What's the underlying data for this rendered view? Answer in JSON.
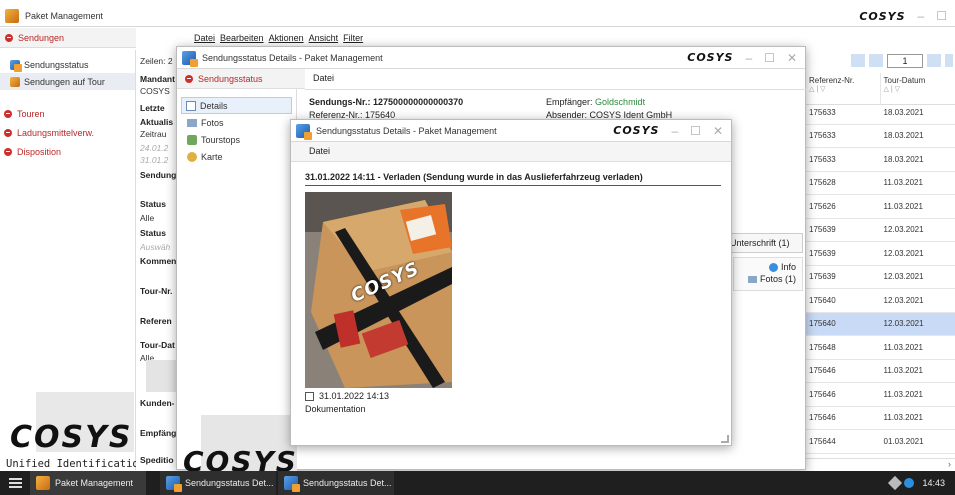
{
  "main_window": {
    "title": "Paket Management",
    "brand": "COSYS",
    "tab": "Sendungen",
    "menu": [
      "Datei",
      "Bearbeiten",
      "Aktionen",
      "Ansicht",
      "Filter"
    ],
    "zeilen_label": "Zeilen: 2",
    "page_number": "1"
  },
  "sidebar": {
    "sub_items": [
      "Sendungsstatus",
      "Sendungen auf Tour"
    ],
    "nav_items": [
      "Touren",
      "Ladungsmittelverw.",
      "Disposition"
    ],
    "logo_text": "COSYS",
    "tagline": "Unified Identification"
  },
  "filter_panel": {
    "rows": [
      {
        "text": "Mandant",
        "bold": true
      },
      {
        "text": "COSYS",
        "bold": false
      },
      {
        "text": "Letzte",
        "bold": true
      },
      {
        "text": "Aktualis",
        "bold": true
      },
      {
        "text": "Zeitrau",
        "bold": false
      },
      {
        "text": "24.01.2",
        "bold": false,
        "muted": true
      },
      {
        "text": "31.01.2",
        "bold": false,
        "muted": true
      },
      {
        "text": "Sendung",
        "bold": true
      },
      {
        "text": "Status",
        "bold": true
      },
      {
        "text": "Alle",
        "bold": false
      },
      {
        "text": "Status",
        "bold": true
      },
      {
        "text": "Auswäh",
        "bold": false,
        "muted": true
      },
      {
        "text": "Kommen",
        "bold": true
      },
      {
        "text": "Tour-Nr.",
        "bold": true
      },
      {
        "text": "Referen",
        "bold": true
      },
      {
        "text": "Tour-Dat",
        "bold": true
      },
      {
        "text": "Alle",
        "bold": false
      },
      {
        "text": "Kunden-",
        "bold": true
      },
      {
        "text": "Empfäng",
        "bold": true
      },
      {
        "text": "Speditio",
        "bold": true
      }
    ]
  },
  "grid": {
    "headers": [
      "Referenz-Nr.",
      "Tour-Datum"
    ],
    "rows": [
      [
        "175633",
        "18.03.2021"
      ],
      [
        "175633",
        "18.03.2021"
      ],
      [
        "175633",
        "18.03.2021"
      ],
      [
        "175628",
        "11.03.2021"
      ],
      [
        "175626",
        "11.03.2021"
      ],
      [
        "175639",
        "12.03.2021"
      ],
      [
        "175639",
        "12.03.2021"
      ],
      [
        "175639",
        "12.03.2021"
      ],
      [
        "175640",
        "12.03.2021"
      ],
      [
        "175640",
        "12.03.2021"
      ],
      [
        "175648",
        "11.03.2021"
      ],
      [
        "175646",
        "11.03.2021"
      ],
      [
        "175646",
        "11.03.2021"
      ],
      [
        "175646",
        "11.03.2021"
      ],
      [
        "175644",
        "01.03.2021"
      ]
    ],
    "selected_row": 9,
    "selected_color": "#c8daf5"
  },
  "details_window": {
    "title": "Sendungsstatus Details - Paket Management",
    "brand": "COSYS",
    "tab": "Sendungsstatus",
    "menu": "Datei",
    "nav": [
      "Details",
      "Fotos",
      "Tourstops",
      "Karte"
    ],
    "sendungs_nr_label": "Sendungs-Nr.:",
    "sendungs_nr": "127500000000000370",
    "referenz_label": "Referenz-Nr.:",
    "referenz": "175640",
    "empfaenger_label": "Empfänger:",
    "empfaenger": "Goldschmidt",
    "absender_label": "Absender:",
    "absender": "COSYS Ident GmbH",
    "unterschrift_btn": "Unterschrift (1)",
    "info_btn": "Info",
    "fotos_btn": "Fotos (1)"
  },
  "photo_window": {
    "title": "Sendungsstatus Details - Paket Management",
    "brand": "COSYS",
    "menu": "Datei",
    "status_line": "31.01.2022 14:11 - Verladen (Sendung wurde in das Auslieferfahrzeug verladen)",
    "photo_caption": "31.01.2022 14:13",
    "photo_label": "Dokumentation",
    "box_print": "COSYS"
  },
  "taskbar": {
    "items": [
      "Paket Management",
      "Sendungsstatus Det...",
      "Sendungsstatus Det..."
    ],
    "time": "14:43"
  },
  "colors": {
    "accent_red": "#cc2f2c",
    "taskbar": "#1f1f1f",
    "link_green": "#2a8a3a"
  }
}
